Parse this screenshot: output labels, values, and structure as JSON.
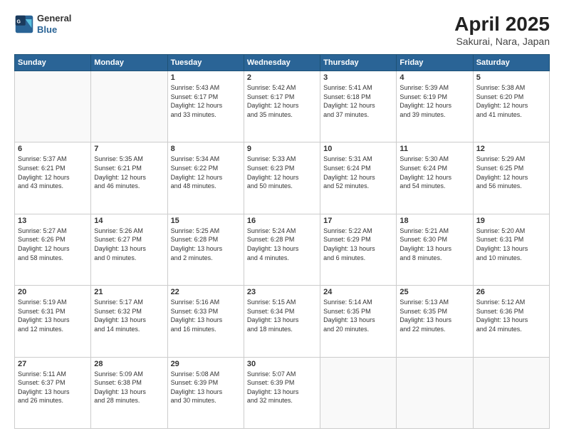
{
  "header": {
    "logo_line1": "General",
    "logo_line2": "Blue",
    "title": "April 2025",
    "subtitle": "Sakurai, Nara, Japan"
  },
  "weekdays": [
    "Sunday",
    "Monday",
    "Tuesday",
    "Wednesday",
    "Thursday",
    "Friday",
    "Saturday"
  ],
  "weeks": [
    [
      {
        "day": "",
        "info": ""
      },
      {
        "day": "",
        "info": ""
      },
      {
        "day": "1",
        "info": "Sunrise: 5:43 AM\nSunset: 6:17 PM\nDaylight: 12 hours\nand 33 minutes."
      },
      {
        "day": "2",
        "info": "Sunrise: 5:42 AM\nSunset: 6:17 PM\nDaylight: 12 hours\nand 35 minutes."
      },
      {
        "day": "3",
        "info": "Sunrise: 5:41 AM\nSunset: 6:18 PM\nDaylight: 12 hours\nand 37 minutes."
      },
      {
        "day": "4",
        "info": "Sunrise: 5:39 AM\nSunset: 6:19 PM\nDaylight: 12 hours\nand 39 minutes."
      },
      {
        "day": "5",
        "info": "Sunrise: 5:38 AM\nSunset: 6:20 PM\nDaylight: 12 hours\nand 41 minutes."
      }
    ],
    [
      {
        "day": "6",
        "info": "Sunrise: 5:37 AM\nSunset: 6:21 PM\nDaylight: 12 hours\nand 43 minutes."
      },
      {
        "day": "7",
        "info": "Sunrise: 5:35 AM\nSunset: 6:21 PM\nDaylight: 12 hours\nand 46 minutes."
      },
      {
        "day": "8",
        "info": "Sunrise: 5:34 AM\nSunset: 6:22 PM\nDaylight: 12 hours\nand 48 minutes."
      },
      {
        "day": "9",
        "info": "Sunrise: 5:33 AM\nSunset: 6:23 PM\nDaylight: 12 hours\nand 50 minutes."
      },
      {
        "day": "10",
        "info": "Sunrise: 5:31 AM\nSunset: 6:24 PM\nDaylight: 12 hours\nand 52 minutes."
      },
      {
        "day": "11",
        "info": "Sunrise: 5:30 AM\nSunset: 6:24 PM\nDaylight: 12 hours\nand 54 minutes."
      },
      {
        "day": "12",
        "info": "Sunrise: 5:29 AM\nSunset: 6:25 PM\nDaylight: 12 hours\nand 56 minutes."
      }
    ],
    [
      {
        "day": "13",
        "info": "Sunrise: 5:27 AM\nSunset: 6:26 PM\nDaylight: 12 hours\nand 58 minutes."
      },
      {
        "day": "14",
        "info": "Sunrise: 5:26 AM\nSunset: 6:27 PM\nDaylight: 13 hours\nand 0 minutes."
      },
      {
        "day": "15",
        "info": "Sunrise: 5:25 AM\nSunset: 6:28 PM\nDaylight: 13 hours\nand 2 minutes."
      },
      {
        "day": "16",
        "info": "Sunrise: 5:24 AM\nSunset: 6:28 PM\nDaylight: 13 hours\nand 4 minutes."
      },
      {
        "day": "17",
        "info": "Sunrise: 5:22 AM\nSunset: 6:29 PM\nDaylight: 13 hours\nand 6 minutes."
      },
      {
        "day": "18",
        "info": "Sunrise: 5:21 AM\nSunset: 6:30 PM\nDaylight: 13 hours\nand 8 minutes."
      },
      {
        "day": "19",
        "info": "Sunrise: 5:20 AM\nSunset: 6:31 PM\nDaylight: 13 hours\nand 10 minutes."
      }
    ],
    [
      {
        "day": "20",
        "info": "Sunrise: 5:19 AM\nSunset: 6:31 PM\nDaylight: 13 hours\nand 12 minutes."
      },
      {
        "day": "21",
        "info": "Sunrise: 5:17 AM\nSunset: 6:32 PM\nDaylight: 13 hours\nand 14 minutes."
      },
      {
        "day": "22",
        "info": "Sunrise: 5:16 AM\nSunset: 6:33 PM\nDaylight: 13 hours\nand 16 minutes."
      },
      {
        "day": "23",
        "info": "Sunrise: 5:15 AM\nSunset: 6:34 PM\nDaylight: 13 hours\nand 18 minutes."
      },
      {
        "day": "24",
        "info": "Sunrise: 5:14 AM\nSunset: 6:35 PM\nDaylight: 13 hours\nand 20 minutes."
      },
      {
        "day": "25",
        "info": "Sunrise: 5:13 AM\nSunset: 6:35 PM\nDaylight: 13 hours\nand 22 minutes."
      },
      {
        "day": "26",
        "info": "Sunrise: 5:12 AM\nSunset: 6:36 PM\nDaylight: 13 hours\nand 24 minutes."
      }
    ],
    [
      {
        "day": "27",
        "info": "Sunrise: 5:11 AM\nSunset: 6:37 PM\nDaylight: 13 hours\nand 26 minutes."
      },
      {
        "day": "28",
        "info": "Sunrise: 5:09 AM\nSunset: 6:38 PM\nDaylight: 13 hours\nand 28 minutes."
      },
      {
        "day": "29",
        "info": "Sunrise: 5:08 AM\nSunset: 6:39 PM\nDaylight: 13 hours\nand 30 minutes."
      },
      {
        "day": "30",
        "info": "Sunrise: 5:07 AM\nSunset: 6:39 PM\nDaylight: 13 hours\nand 32 minutes."
      },
      {
        "day": "",
        "info": ""
      },
      {
        "day": "",
        "info": ""
      },
      {
        "day": "",
        "info": ""
      }
    ]
  ]
}
